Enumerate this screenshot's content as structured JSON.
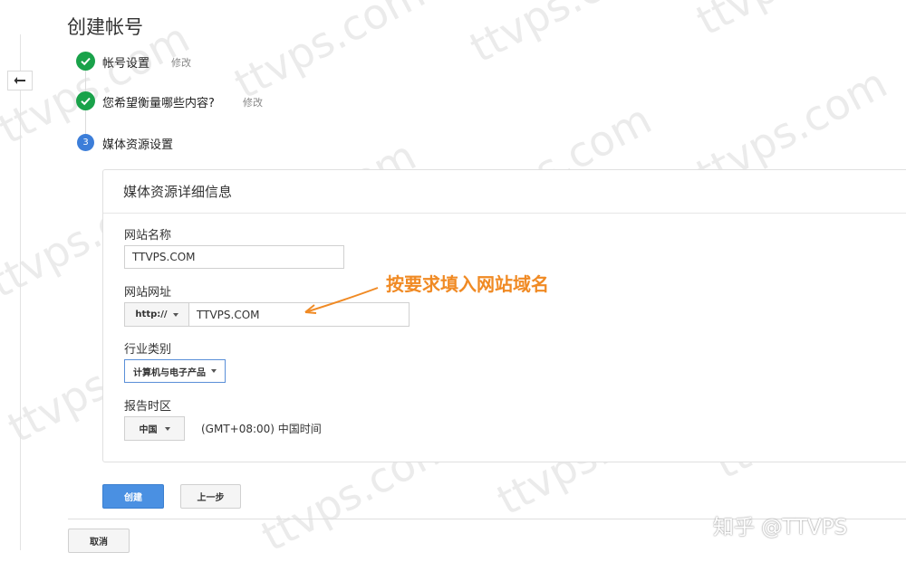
{
  "page": {
    "title": "创建帐号"
  },
  "steps": [
    {
      "label": "帐号设置",
      "state": "done",
      "edit_label": "修改"
    },
    {
      "label": "您希望衡量哪些内容?",
      "state": "done",
      "edit_label": "修改"
    },
    {
      "label": "媒体资源设置",
      "state": "current",
      "number": "3"
    }
  ],
  "panel": {
    "title": "媒体资源详细信息",
    "site_name": {
      "label": "网站名称",
      "value": "TTVPS.COM"
    },
    "site_url": {
      "label": "网站网址",
      "protocol": "http://",
      "value": "TTVPS.COM"
    },
    "industry": {
      "label": "行业类别",
      "selected": "计算机与电子产品"
    },
    "timezone": {
      "label": "报告时区",
      "country": "中国",
      "zone": "(GMT+08:00) 中国时间"
    }
  },
  "annotation": {
    "text": "按要求填入网站域名"
  },
  "buttons": {
    "create": "创建",
    "prev": "上一步",
    "cancel": "取消"
  },
  "credit": "知乎 @TTVPS",
  "watermark": "ttvps.com",
  "colors": {
    "check_green": "#19a24a",
    "step_blue": "#3c7ed9",
    "primary_button": "#4a90e2",
    "annotation_orange": "#f08a24"
  }
}
